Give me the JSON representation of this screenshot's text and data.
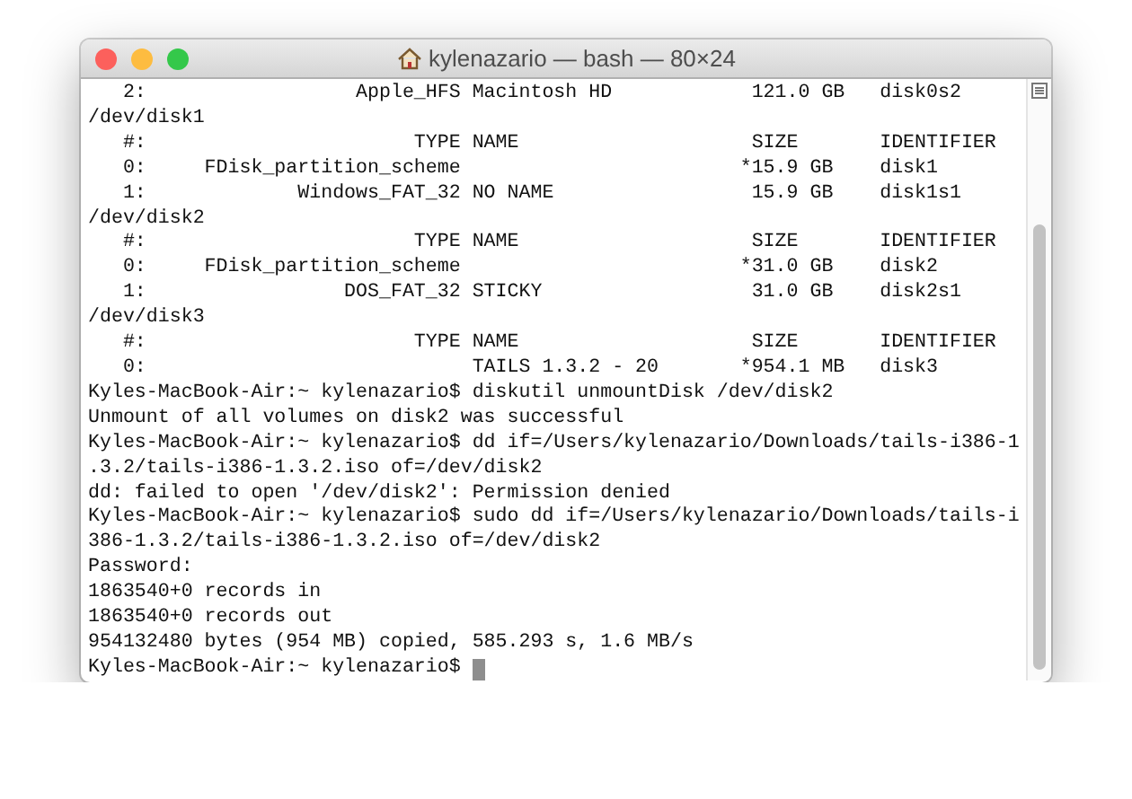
{
  "window": {
    "title": "kylenazario — bash — 80×24"
  },
  "terminal": {
    "lines": [
      "   2:                  Apple_HFS Macintosh HD            121.0 GB   disk0s2",
      "/dev/disk1",
      "   #:                       TYPE NAME                    SIZE       IDENTIFIER",
      "   0:     FDisk_partition_scheme                        *15.9 GB    disk1",
      "   1:             Windows_FAT_32 NO NAME                 15.9 GB    disk1s1",
      "/dev/disk2",
      "   #:                       TYPE NAME                    SIZE       IDENTIFIER",
      "   0:     FDisk_partition_scheme                        *31.0 GB    disk2",
      "   1:                 DOS_FAT_32 STICKY                  31.0 GB    disk2s1",
      "/dev/disk3",
      "   #:                       TYPE NAME                    SIZE       IDENTIFIER",
      "   0:                            TAILS 1.3.2 - 20       *954.1 MB   disk3",
      "Kyles-MacBook-Air:~ kylenazario$ diskutil unmountDisk /dev/disk2",
      "Unmount of all volumes on disk2 was successful",
      "Kyles-MacBook-Air:~ kylenazario$ dd if=/Users/kylenazario/Downloads/tails-i386-1",
      ".3.2/tails-i386-1.3.2.iso of=/dev/disk2",
      "dd: failed to open '/dev/disk2': Permission denied",
      "Kyles-MacBook-Air:~ kylenazario$ sudo dd if=/Users/kylenazario/Downloads/tails-i",
      "386-1.3.2/tails-i386-1.3.2.iso of=/dev/disk2",
      "Password:",
      "1863540+0 records in",
      "1863540+0 records out",
      "954132480 bytes (954 MB) copied, 585.293 s, 1.6 MB/s"
    ],
    "prompt": "Kyles-MacBook-Air:~ kylenazario$"
  }
}
